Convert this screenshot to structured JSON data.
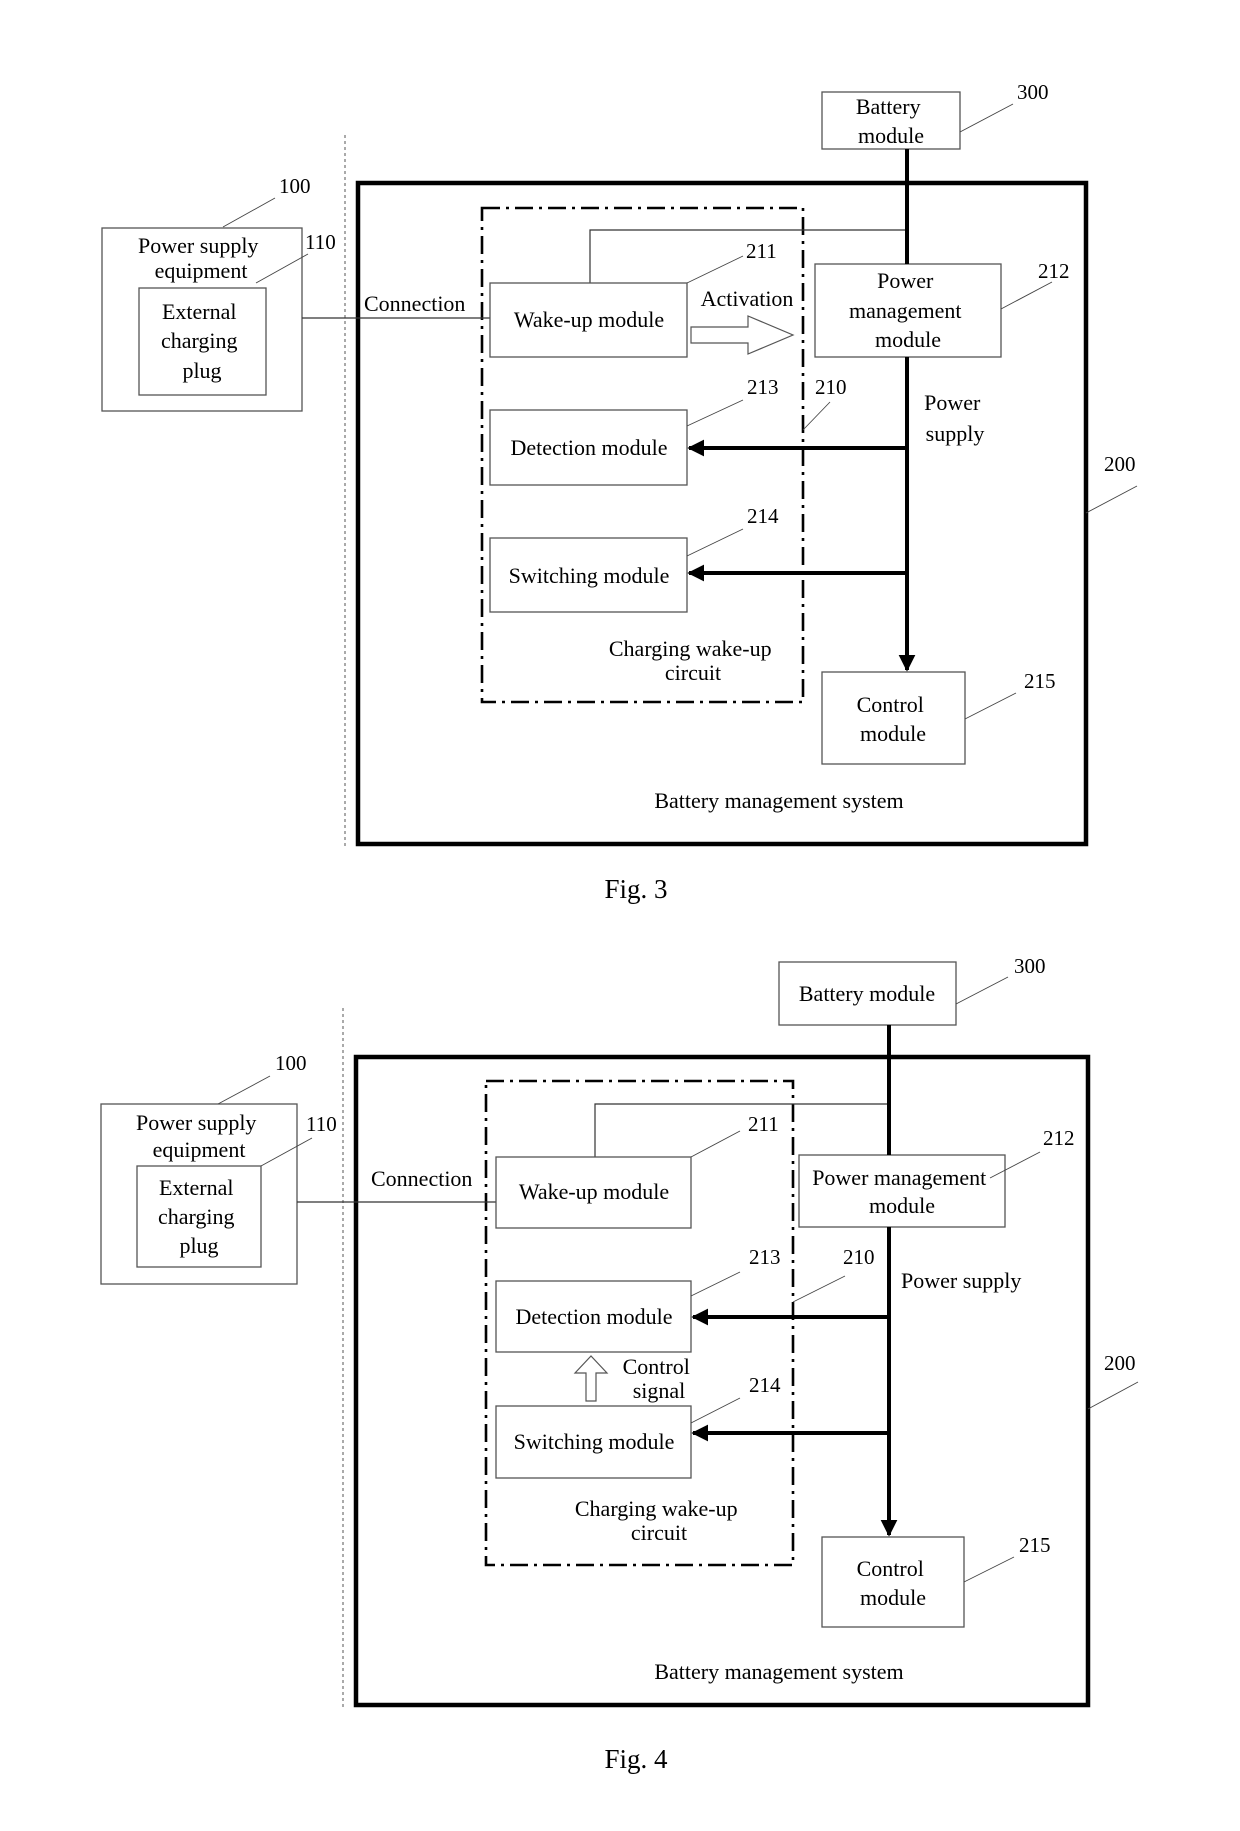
{
  "figures": [
    {
      "caption": "Fig. 3",
      "power_supply_equipment": {
        "label_lines": [
          "Power supply",
          "equipment"
        ],
        "ref": "100"
      },
      "external_charging_plug": {
        "label_lines": [
          "External",
          "charging",
          "plug"
        ],
        "ref": "110"
      },
      "battery_management_system": {
        "label": "Battery management system",
        "ref": "200"
      },
      "charging_wakeup_circuit": {
        "label_lines": [
          "Charging wake-up",
          "circuit"
        ],
        "ref": "210"
      },
      "wakeup_module": {
        "label": "Wake-up module",
        "ref": "211"
      },
      "power_management_module": {
        "label_lines": [
          "Power",
          "management",
          "module"
        ],
        "ref": "212"
      },
      "detection_module": {
        "label": "Detection module",
        "ref": "213"
      },
      "switching_module": {
        "label": "Switching module",
        "ref": "214"
      },
      "control_module": {
        "label_lines": [
          "Control",
          "module"
        ],
        "ref": "215"
      },
      "battery_module": {
        "label_lines": [
          "Battery",
          "module"
        ],
        "ref": "300"
      },
      "connection_label": "Connection",
      "activation_label": "Activation",
      "power_supply_label_lines": [
        "Power",
        "supply"
      ]
    },
    {
      "caption": "Fig. 4",
      "power_supply_equipment": {
        "label_lines": [
          "Power supply",
          "equipment"
        ],
        "ref": "100"
      },
      "external_charging_plug": {
        "label_lines": [
          "External",
          "charging",
          "plug"
        ],
        "ref": "110"
      },
      "battery_management_system": {
        "label": "Battery management system",
        "ref": "200"
      },
      "charging_wakeup_circuit": {
        "label_lines": [
          "Charging wake-up",
          "circuit"
        ],
        "ref": "210"
      },
      "wakeup_module": {
        "label": "Wake-up module",
        "ref": "211"
      },
      "power_management_module": {
        "label_lines": [
          "Power management",
          "module"
        ],
        "ref": "212"
      },
      "detection_module": {
        "label": "Detection module",
        "ref": "213"
      },
      "switching_module": {
        "label": "Switching module",
        "ref": "214"
      },
      "control_module": {
        "label_lines": [
          "Control",
          "module"
        ],
        "ref": "215"
      },
      "battery_module": {
        "label": "Battery module",
        "ref": "300"
      },
      "connection_label": "Connection",
      "control_signal_label_lines": [
        "Control",
        "signal"
      ],
      "power_supply_label": "Power supply"
    }
  ]
}
